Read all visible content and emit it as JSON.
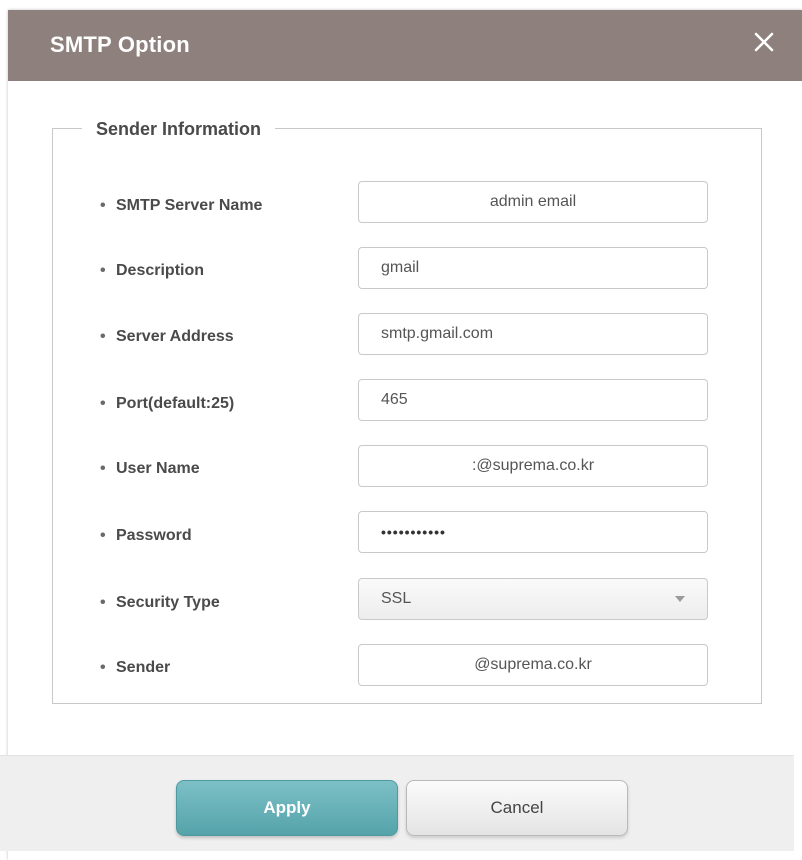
{
  "dialog": {
    "title": "SMTP Option",
    "close_icon": "close-icon"
  },
  "section": {
    "legend": "Sender Information"
  },
  "fields": {
    "smtp_server_name": {
      "label": "SMTP Server Name",
      "value": "admin email"
    },
    "description": {
      "label": "Description",
      "value": "gmail"
    },
    "server_address": {
      "label": "Server Address",
      "value": "smtp.gmail.com"
    },
    "port": {
      "label": "Port(default:25)",
      "value": "465"
    },
    "user_name": {
      "label": "User Name",
      "value": ":@suprema.co.kr"
    },
    "password": {
      "label": "Password",
      "value": "•••••••••••"
    },
    "security_type": {
      "label": "Security Type",
      "value": "SSL"
    },
    "sender": {
      "label": "Sender",
      "value": "@suprema.co.kr"
    }
  },
  "buttons": {
    "apply": "Apply",
    "cancel": "Cancel"
  },
  "colors": {
    "titlebar": "#8e807c",
    "apply_button": "#62adb3"
  }
}
